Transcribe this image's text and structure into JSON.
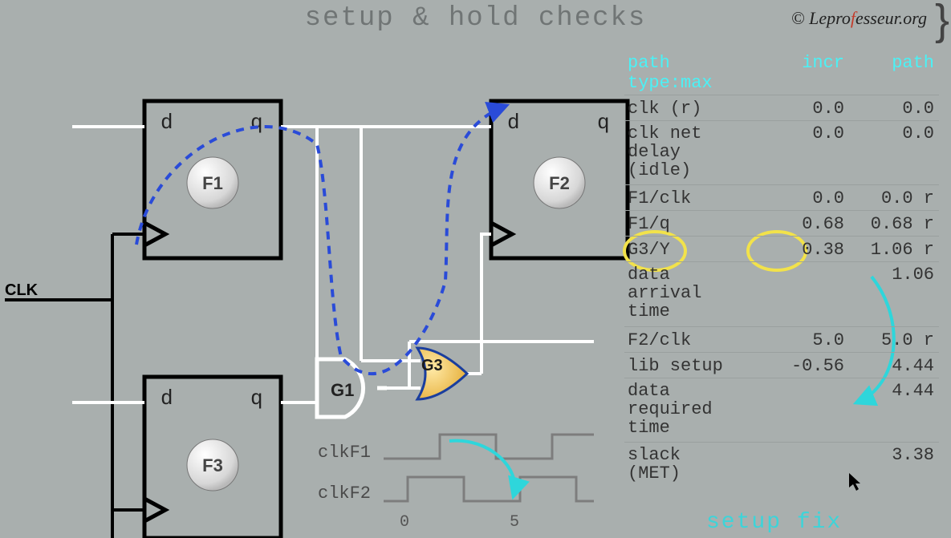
{
  "title": "setup & hold checks",
  "copyright": {
    "pre": "© ",
    "a": "Lepro",
    "f": "f",
    "b": "esseur.org"
  },
  "labels": {
    "clk": "CLK",
    "f1": "F1",
    "f2": "F2",
    "f3": "F3",
    "g1": "G1",
    "g3": "G3",
    "d": "d",
    "q": "q",
    "clkF1": "clkF1",
    "clkF2": "clkF2",
    "tick0": "0",
    "tick5": "5"
  },
  "setup_fix": "setup fix",
  "timing": {
    "header": {
      "c0a": "path",
      "c0b": "type:max",
      "c1": "incr",
      "c2": "path"
    },
    "rows": [
      {
        "c0": "clk (r)",
        "c1": "0.0",
        "c2": "0.0"
      },
      {
        "c0": "clk net\ndelay\n(idle)",
        "c1": "0.0",
        "c2": "0.0",
        "tall": true
      },
      {
        "c0": "F1/clk",
        "c1": "0.0",
        "c2": "0.0 r"
      },
      {
        "c0": "F1/q",
        "c1": "0.68",
        "c2": "0.68 r"
      },
      {
        "c0": "G3/Y",
        "c1": "0.38",
        "c2": "1.06 r"
      },
      {
        "c0": "data\narrival\ntime",
        "c1": "",
        "c2": "1.06",
        "tall": true
      },
      {
        "c0": "F2/clk",
        "c1": "5.0",
        "c2": "5.0 r"
      },
      {
        "c0": "lib setup",
        "c1": "-0.56",
        "c2": "4.44"
      },
      {
        "c0": "data\nrequired\ntime",
        "c1": "",
        "c2": "4.44",
        "tall": true
      },
      {
        "c0": "slack\n(MET)",
        "c1": "",
        "c2": "3.38",
        "tall": true,
        "last": true
      }
    ]
  }
}
